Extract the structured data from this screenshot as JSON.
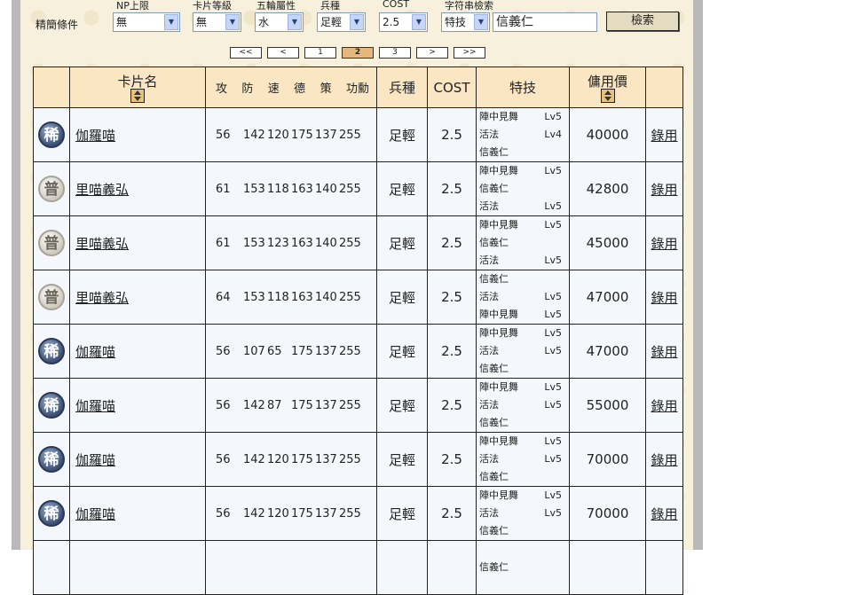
{
  "filters": {
    "title": "精簡條件",
    "np": {
      "label": "NP上限",
      "value": "無"
    },
    "level": {
      "label": "卡片等級",
      "value": "無"
    },
    "element": {
      "label": "五輪屬性",
      "value": "水"
    },
    "unit": {
      "label": "兵種",
      "value": "足輕"
    },
    "cost": {
      "label": "COST",
      "value": "2.5"
    },
    "search_type": {
      "label": "字符串檢索",
      "value": "特技"
    },
    "search_text": "信義仁",
    "search_button": "檢索"
  },
  "pager": [
    "<<",
    "<",
    "1",
    "2",
    "3",
    ">",
    ">>"
  ],
  "table": {
    "headers": {
      "name": "卡片名",
      "stats": [
        "攻",
        "防",
        "速",
        "德",
        "策",
        "功勳"
      ],
      "unit": "兵種",
      "cost": "COST",
      "skill": "特技",
      "price": "傭用價"
    },
    "rows": [
      {
        "rarity": "稀",
        "rarity_type": "rare",
        "name": "伽羅喵",
        "stats": [
          "56",
          "142",
          "120",
          "175",
          "137",
          "255"
        ],
        "unit": "足輕",
        "cost": "2.5",
        "skills": [
          {
            "name": "陣中見舞",
            "lv": "Lv5"
          },
          {
            "name": "活法",
            "lv": "Lv4"
          },
          {
            "name": "信義仁",
            "lv": ""
          }
        ],
        "price": "40000",
        "action": "錄用"
      },
      {
        "rarity": "普",
        "rarity_type": "common",
        "name": "里喵義弘",
        "stats": [
          "61",
          "153",
          "118",
          "163",
          "140",
          "255"
        ],
        "unit": "足輕",
        "cost": "2.5",
        "skills": [
          {
            "name": "陣中見舞",
            "lv": "Lv5"
          },
          {
            "name": "信義仁",
            "lv": ""
          },
          {
            "name": "活法",
            "lv": "Lv5"
          }
        ],
        "price": "42800",
        "action": "錄用"
      },
      {
        "rarity": "普",
        "rarity_type": "common",
        "name": "里喵義弘",
        "stats": [
          "61",
          "153",
          "123",
          "163",
          "140",
          "255"
        ],
        "unit": "足輕",
        "cost": "2.5",
        "skills": [
          {
            "name": "陣中見舞",
            "lv": "Lv5"
          },
          {
            "name": "信義仁",
            "lv": ""
          },
          {
            "name": "活法",
            "lv": "Lv5"
          }
        ],
        "price": "45000",
        "action": "錄用"
      },
      {
        "rarity": "普",
        "rarity_type": "common",
        "name": "里喵義弘",
        "stats": [
          "64",
          "153",
          "118",
          "163",
          "140",
          "255"
        ],
        "unit": "足輕",
        "cost": "2.5",
        "skills": [
          {
            "name": "信義仁",
            "lv": ""
          },
          {
            "name": "活法",
            "lv": "Lv5"
          },
          {
            "name": "陣中見舞",
            "lv": "Lv5"
          }
        ],
        "price": "47000",
        "action": "錄用"
      },
      {
        "rarity": "稀",
        "rarity_type": "rare",
        "name": "伽羅喵",
        "stats": [
          "56",
          "107",
          "65",
          "175",
          "137",
          "255"
        ],
        "unit": "足輕",
        "cost": "2.5",
        "skills": [
          {
            "name": "陣中見舞",
            "lv": "Lv5"
          },
          {
            "name": "活法",
            "lv": "Lv5"
          },
          {
            "name": "信義仁",
            "lv": ""
          }
        ],
        "price": "47000",
        "action": "錄用"
      },
      {
        "rarity": "稀",
        "rarity_type": "rare",
        "name": "伽羅喵",
        "stats": [
          "56",
          "142",
          "87",
          "175",
          "137",
          "255"
        ],
        "unit": "足輕",
        "cost": "2.5",
        "skills": [
          {
            "name": "陣中見舞",
            "lv": "Lv5"
          },
          {
            "name": "活法",
            "lv": "Lv5"
          },
          {
            "name": "信義仁",
            "lv": ""
          }
        ],
        "price": "55000",
        "action": "錄用"
      },
      {
        "rarity": "稀",
        "rarity_type": "rare",
        "name": "伽羅喵",
        "stats": [
          "56",
          "142",
          "120",
          "175",
          "137",
          "255"
        ],
        "unit": "足輕",
        "cost": "2.5",
        "skills": [
          {
            "name": "陣中見舞",
            "lv": "Lv5"
          },
          {
            "name": "活法",
            "lv": "Lv5"
          },
          {
            "name": "信義仁",
            "lv": ""
          }
        ],
        "price": "70000",
        "action": "錄用"
      },
      {
        "rarity": "稀",
        "rarity_type": "rare",
        "name": "伽羅喵",
        "stats": [
          "56",
          "142",
          "120",
          "175",
          "137",
          "255"
        ],
        "unit": "足輕",
        "cost": "2.5",
        "skills": [
          {
            "name": "陣中見舞",
            "lv": "Lv5"
          },
          {
            "name": "活法",
            "lv": "Lv5"
          },
          {
            "name": "信義仁",
            "lv": ""
          }
        ],
        "price": "70000",
        "action": "錄用"
      },
      {
        "rarity": "",
        "rarity_type": "rare",
        "name": "",
        "stats": [
          "",
          "",
          "",
          "",
          "",
          ""
        ],
        "unit": "",
        "cost": "",
        "skills": [
          {
            "name": "信義仁",
            "lv": ""
          }
        ],
        "price": "",
        "action": ""
      }
    ]
  }
}
